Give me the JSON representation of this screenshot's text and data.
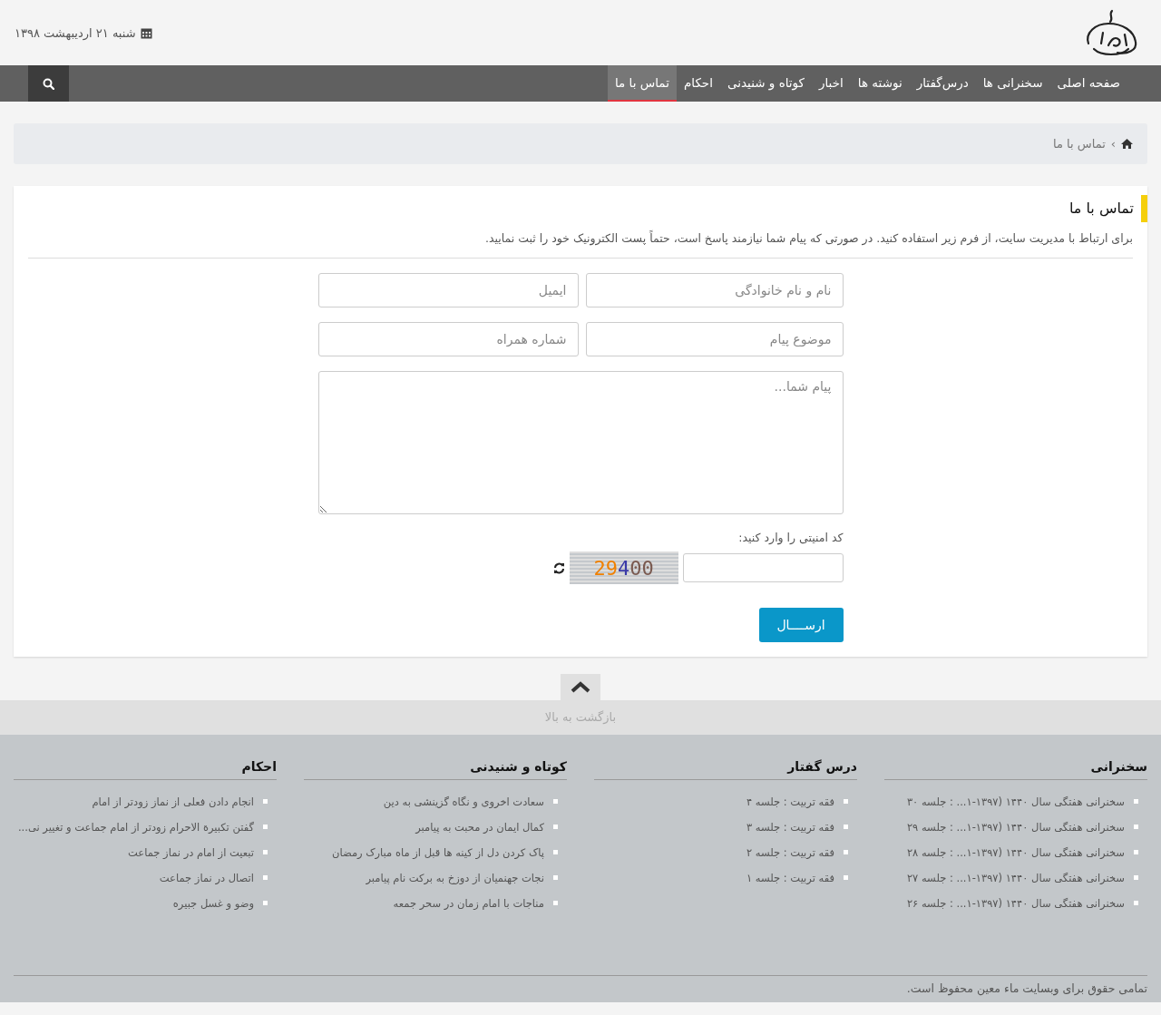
{
  "header": {
    "date": "شنبه ۲۱ اردیبهشت ۱۳۹۸"
  },
  "nav": {
    "items": [
      {
        "label": "صفحه اصلی",
        "selected": false
      },
      {
        "label": "سخنرانی ها",
        "selected": false
      },
      {
        "label": "درس‌گفتار",
        "selected": false
      },
      {
        "label": "نوشته ها",
        "selected": false
      },
      {
        "label": "اخبار",
        "selected": false
      },
      {
        "label": "کوتاه و شنیدنی",
        "selected": false
      },
      {
        "label": "احکام",
        "selected": false
      },
      {
        "label": "تماس با ما",
        "selected": true
      }
    ]
  },
  "breadcrumb": {
    "separator": "›",
    "items": [
      "تماس با ما"
    ]
  },
  "contact": {
    "title": "تماس با ما",
    "intro": "برای ارتباط با مدیریت سایت، از فرم زیر استفاده کنید. در صورتی که پیام شما نیازمند پاسخ است، حتماً پست الکترونیک خود را ثبت نمایید.",
    "fields": [
      {
        "placeholder": "نام و نام خانوادگی"
      },
      {
        "placeholder": "ایمیل"
      },
      {
        "placeholder": "موضوع پیام"
      },
      {
        "placeholder": "شماره همراه"
      }
    ],
    "message": {
      "placeholder": "پیام شما..."
    },
    "captcha_label": "کد امنیتی را وارد کنید:",
    "captcha_code": "29400",
    "submit": "ارســــال"
  },
  "back_to_top": "بازگشت به بالا",
  "footer": {
    "columns": [
      {
        "title": "سخنرانی",
        "items": [
          "سخنرانی هفتگی سال ۱۴۴۰ (۱۳۹۷-۱... : جلسه ۳۰",
          "سخنرانی هفتگی سال ۱۴۴۰ (۱۳۹۷-۱... : جلسه ۲۹",
          "سخنرانی هفتگی سال ۱۴۴۰ (۱۳۹۷-۱... : جلسه ۲۸",
          "سخنرانی هفتگی سال ۱۴۴۰ (۱۳۹۷-۱... : جلسه ۲۷",
          "سخنرانی هفتگی سال ۱۴۴۰ (۱۳۹۷-۱... : جلسه ۲۶"
        ]
      },
      {
        "title": "درس گفتار",
        "items": [
          "فقه تربیت : جلسه ۴",
          "فقه تربیت : جلسه ۳",
          "فقه تربیت : جلسه ۲",
          "فقه تربیت : جلسه ۱"
        ]
      },
      {
        "title": "کوتاه و شنیدنی",
        "items": [
          "سعادت اخروی و نگاه گزینشی به دین",
          "کمال ایمان در محبت به پیامبر",
          "پاک کردن دل از کینه ها قبل از ماه مبارک رمضان",
          "نجات جهنمیان از دوزخ به برکت نام پیامبر",
          "مناجات با امام زمان در سحر جمعه"
        ]
      },
      {
        "title": "احکام",
        "items": [
          "انجام دادن فعلی از نماز زودتر از امام",
          "گفتن تکبیرة الاحرام زودتر از امام جماعت و تغییر نی...",
          "تبعیت از امام در نماز جماعت",
          "اتصال در نماز جماعت",
          "وضو و غسل جبیره"
        ]
      }
    ],
    "copyright": "تمامی حقوق برای وبسایت ماء معین محفوظ است."
  }
}
